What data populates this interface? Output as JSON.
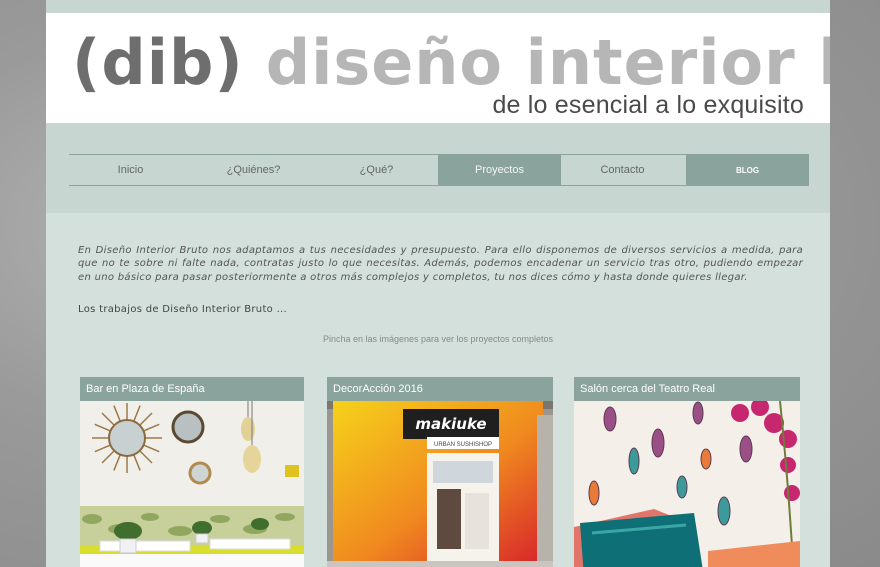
{
  "header": {
    "logo_dib": "(dib)",
    "logo_name": "diseño interior bruto",
    "tagline": "de lo esencial a lo exquisito"
  },
  "nav": {
    "items": [
      {
        "label": "Inicio"
      },
      {
        "label": "¿Quiénes?"
      },
      {
        "label": "¿Qué?"
      },
      {
        "label": "Proyectos",
        "active": true
      },
      {
        "label": "Contacto"
      },
      {
        "label": "BLOG"
      }
    ]
  },
  "content": {
    "intro": "En Diseño Interior Bruto nos adaptamos a tus necesidades y presupuesto. Para ello disponemos de diversos servicios a medida, para que no te sobre ni falte nada, contratas justo lo que necesitas. Además, podemos encadenar un servicio tras otro, pudiendo empezar en uno básico para pasar posteriormente a otros más complejos y completos, tu nos dices cómo y hasta donde quieres llegar.",
    "trabajos": "Los trabajos de Diseño Interior Bruto ...",
    "pincha": "Pincha en las imágenes para ver los proyectos completos"
  },
  "projects": [
    {
      "title": "Bar en Plaza de España"
    },
    {
      "title": "DecorAcción 2016",
      "sign": "makiuke",
      "sign_sub": "URBAN SUSHISHOP"
    },
    {
      "title": "Salón cerca del Teatro Real"
    }
  ],
  "colors": {
    "page_bg": "#d3e0db",
    "band": "#c7d6d1",
    "accent": "#8aa39c"
  }
}
